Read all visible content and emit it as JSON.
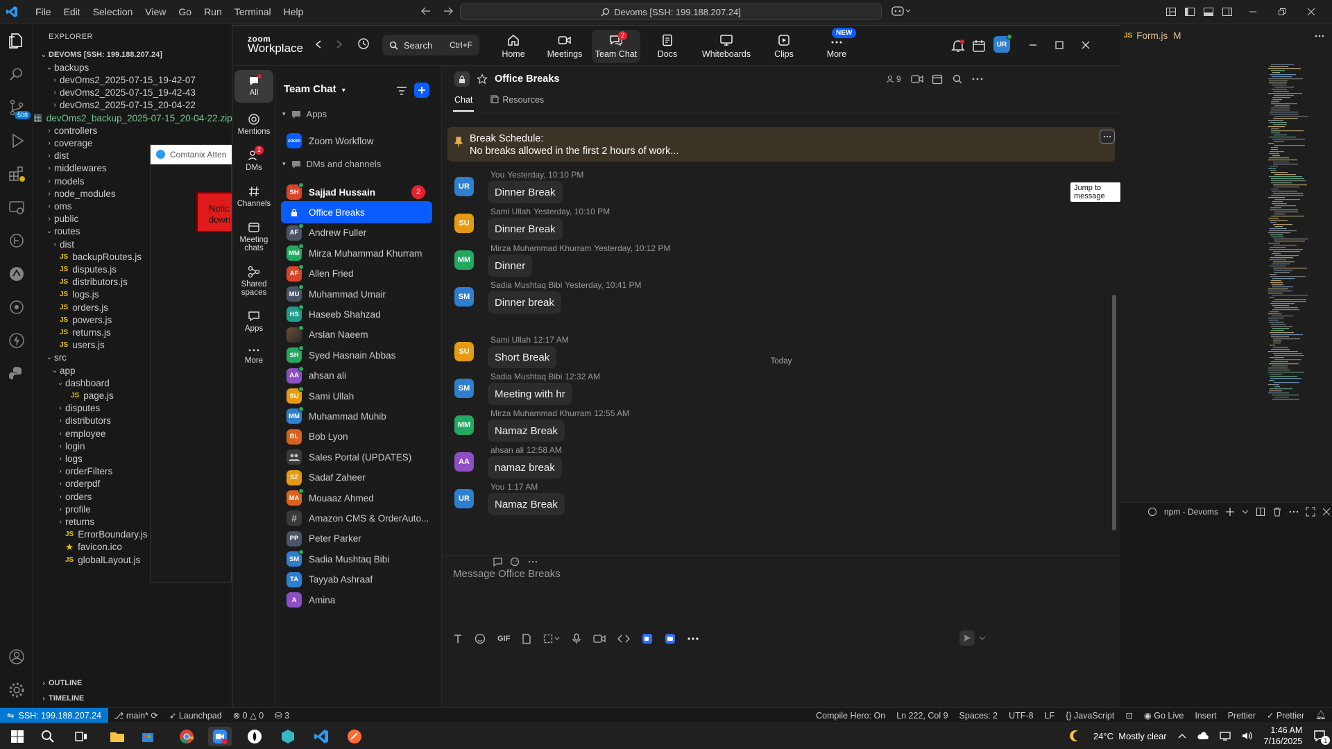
{
  "vscode": {
    "menu": [
      "File",
      "Edit",
      "Selection",
      "View",
      "Go",
      "Run",
      "Terminal",
      "Help"
    ],
    "command_center": "Devoms [SSH: 199.188.207.24]",
    "activity_badge": "508",
    "explorer_title": "EXPLORER",
    "tree": [
      {
        "label": "DEVOMS [SSH: 199.188.207.24]",
        "type": "root"
      },
      {
        "label": "backups",
        "type": "folder-open",
        "indent": 1
      },
      {
        "label": "devOms2_2025-07-15_19-42-07",
        "type": "folder",
        "indent": 2
      },
      {
        "label": "devOms2_2025-07-15_19-42-43",
        "type": "folder",
        "indent": 2
      },
      {
        "label": "devOms2_2025-07-15_20-04-22",
        "type": "folder",
        "indent": 2
      },
      {
        "label": "devOms2_backup_2025-07-15_20-04-22.zip",
        "type": "file-green",
        "indent": 2
      },
      {
        "label": "controllers",
        "type": "folder",
        "indent": 1
      },
      {
        "label": "coverage",
        "type": "folder",
        "indent": 1
      },
      {
        "label": "dist",
        "type": "folder",
        "indent": 1
      },
      {
        "label": "middlewares",
        "type": "folder",
        "indent": 1
      },
      {
        "label": "models",
        "type": "folder",
        "indent": 1
      },
      {
        "label": "node_modules",
        "type": "folder",
        "indent": 1
      },
      {
        "label": "oms",
        "type": "folder",
        "indent": 1
      },
      {
        "label": "public",
        "type": "folder",
        "indent": 1
      },
      {
        "label": "routes",
        "type": "folder-open",
        "indent": 1
      },
      {
        "label": "dist",
        "type": "folder",
        "indent": 2
      },
      {
        "label": "backupRoutes.js",
        "type": "js",
        "indent": 2
      },
      {
        "label": "disputes.js",
        "type": "js",
        "indent": 2
      },
      {
        "label": "distributors.js",
        "type": "js",
        "indent": 2
      },
      {
        "label": "logs.js",
        "type": "js",
        "indent": 2
      },
      {
        "label": "orders.js",
        "type": "js",
        "indent": 2
      },
      {
        "label": "powers.js",
        "type": "js",
        "indent": 2
      },
      {
        "label": "returns.js",
        "type": "js",
        "indent": 2
      },
      {
        "label": "users.js",
        "type": "js",
        "indent": 2
      },
      {
        "label": "src",
        "type": "folder-open",
        "indent": 1
      },
      {
        "label": "app",
        "type": "folder-open",
        "indent": 2
      },
      {
        "label": "dashboard",
        "type": "folder-open",
        "indent": 3
      },
      {
        "label": "page.js",
        "type": "js",
        "indent": 4
      },
      {
        "label": "disputes",
        "type": "folder",
        "indent": 3
      },
      {
        "label": "distributors",
        "type": "folder",
        "indent": 3
      },
      {
        "label": "employee",
        "type": "folder",
        "indent": 3
      },
      {
        "label": "login",
        "type": "folder",
        "indent": 3
      },
      {
        "label": "logs",
        "type": "folder",
        "indent": 3
      },
      {
        "label": "orderFilters",
        "type": "folder",
        "indent": 3
      },
      {
        "label": "orderpdf",
        "type": "folder",
        "indent": 3
      },
      {
        "label": "orders",
        "type": "folder",
        "indent": 3
      },
      {
        "label": "profile",
        "type": "folder",
        "indent": 3
      },
      {
        "label": "returns",
        "type": "folder",
        "indent": 3
      },
      {
        "label": "ErrorBoundary.js",
        "type": "js",
        "indent": 3
      },
      {
        "label": "favicon.ico",
        "type": "star",
        "indent": 3
      },
      {
        "label": "globalLayout.js",
        "type": "js",
        "indent": 3
      }
    ],
    "outline": "OUTLINE",
    "timeline": "TIMELINE",
    "behind_tab": "Comtanix Atten",
    "behind_notice": "Notic down",
    "editor_tab": "Form.js",
    "editor_tab_status": "M",
    "terminal_label": "npm - Devoms",
    "status": {
      "remote": "SSH: 199.188.207.24",
      "branch": "main*",
      "launchpad": "Launchpad",
      "problems": "0",
      "warnings": "0",
      "ports": "3",
      "compile_hero": "Compile Hero: On",
      "position": "Ln 222, Col 9",
      "spaces": "Spaces: 2",
      "encoding": "UTF-8",
      "eol": "LF",
      "language": "JavaScript",
      "golive": "Go Live",
      "mode": "Insert",
      "prettier1": "Prettier",
      "prettier2": "Prettier"
    }
  },
  "zoom": {
    "logo_top": "zoom",
    "logo_bottom": "Workplace",
    "search_label": "Search",
    "search_shortcut": "Ctrl+F",
    "nav": [
      {
        "label": "Home"
      },
      {
        "label": "Meetings"
      },
      {
        "label": "Team Chat",
        "badge": "2"
      },
      {
        "label": "Docs"
      },
      {
        "label": "Whiteboards"
      },
      {
        "label": "Clips"
      },
      {
        "label": "More",
        "tag": "NEW"
      }
    ],
    "avatar": "UR",
    "rail": [
      {
        "label": "All"
      },
      {
        "label": "Mentions"
      },
      {
        "label": "DMs",
        "badge": "2"
      },
      {
        "label": "Channels"
      },
      {
        "label": "Meeting chats"
      },
      {
        "label": "Shared spaces"
      },
      {
        "label": "Apps"
      },
      {
        "label": "More"
      }
    ],
    "list_title": "Team Chat",
    "section_apps": "Apps",
    "section_dms": "DMs and channels",
    "apps": [
      {
        "name": "Zoom Workflow",
        "initials": "zoom",
        "color": "#0b5cff"
      }
    ],
    "conversations": [
      {
        "name": "Sajjad Hussain",
        "initials": "SH",
        "color": "#d8452b",
        "badge": "2",
        "bold": true,
        "online": true
      },
      {
        "name": "Office Breaks",
        "initials": "",
        "color": "#0b5cff",
        "selected": true,
        "lock": true
      },
      {
        "name": "Andrew Fuller",
        "initials": "AF",
        "color": "#4a5568",
        "online": true
      },
      {
        "name": "Mirza Muhammad Khurram",
        "initials": "MM",
        "color": "#22a860",
        "online": true
      },
      {
        "name": "Allen Fried",
        "initials": "AF",
        "color": "#d8452b",
        "online": true
      },
      {
        "name": "Muhammad Umair",
        "initials": "MU",
        "color": "#4a5568",
        "online": true
      },
      {
        "name": "Haseeb Shahzad",
        "initials": "HS",
        "color": "#1e9e8a",
        "online": true
      },
      {
        "name": "Arslan Naeem",
        "initials": "",
        "color": "#6b4f3a",
        "online": true
      },
      {
        "name": "Syed Hasnain Abbas",
        "initials": "SH",
        "color": "#22a860",
        "online": true
      },
      {
        "name": "ahsan ali",
        "initials": "AA",
        "color": "#8e4ec6",
        "online": true
      },
      {
        "name": "Sami Ullah",
        "initials": "SU",
        "color": "#e59a12",
        "online": true
      },
      {
        "name": "Muhammad Muhib",
        "initials": "MM",
        "color": "#2f7fd1",
        "online": true
      },
      {
        "name": "Bob Lyon",
        "initials": "BL",
        "color": "#d9631e",
        "online": false
      },
      {
        "name": "Sales Portal (UPDATES)",
        "initials": "",
        "color": "#3a3a3a",
        "group": true
      },
      {
        "name": "Sadaf Zaheer",
        "initials": "SZ",
        "color": "#e59a12",
        "online": false
      },
      {
        "name": "Mouaaz Ahmed",
        "initials": "MA",
        "color": "#d9631e",
        "online": true
      },
      {
        "name": "Amazon CMS & OrderAuto...",
        "initials": "#",
        "color": "#3a3a3a",
        "channel": true
      },
      {
        "name": "Peter Parker",
        "initials": "PP",
        "color": "#4a5568",
        "online": false
      },
      {
        "name": "Sadia Mushtaq Bibi",
        "initials": "SM",
        "color": "#2f7fd1",
        "online": true
      },
      {
        "name": "Tayyab Ashraaf",
        "initials": "TA",
        "color": "#2f7fd1",
        "online": false
      },
      {
        "name": "Amina",
        "initials": "A",
        "color": "#8e4ec6",
        "online": false
      }
    ],
    "chat": {
      "title": "Office Breaks",
      "member_count": "9",
      "tab_chat": "Chat",
      "tab_resources": "Resources",
      "pinned_title": "Break Schedule:",
      "pinned_text": "No breaks allowed in the first 2 hours of work...",
      "jump_tooltip": "Jump to message",
      "today": "Today",
      "messages": [
        {
          "sender": "You",
          "time": "Yesterday, 10:10 PM",
          "text": "Dinner Break",
          "initials": "UR",
          "color": "#2f7fd1"
        },
        {
          "sender": "Sami Ullah",
          "time": "Yesterday, 10:10 PM",
          "text": "Dinner Break",
          "initials": "SU",
          "color": "#e59a12"
        },
        {
          "sender": "Mirza Muhammad Khurram",
          "time": "Yesterday, 10:12 PM",
          "text": "Dinner",
          "initials": "MM",
          "color": "#22a860"
        },
        {
          "sender": "Sadia Mushtaq Bibi",
          "time": "Yesterday, 10:41 PM",
          "text": "Dinner break",
          "initials": "SM",
          "color": "#2f7fd1"
        },
        {
          "sender": "Sami Ullah",
          "time": "12:17 AM",
          "text": "Short Break",
          "initials": "SU",
          "color": "#e59a12"
        },
        {
          "sender": "Sadia Mushtaq Bibi",
          "time": "12:32 AM",
          "text": "Meeting with hr",
          "initials": "SM",
          "color": "#2f7fd1"
        },
        {
          "sender": "Mirza Muhammad Khurram",
          "time": "12:55 AM",
          "text": "Namaz Break",
          "initials": "MM",
          "color": "#22a860"
        },
        {
          "sender": "ahsan ali",
          "time": "12:58 AM",
          "text": "namaz break",
          "initials": "AA",
          "color": "#8e4ec6"
        },
        {
          "sender": "You",
          "time": "1:17 AM",
          "text": "Namaz Break",
          "initials": "UR",
          "color": "#2f7fd1"
        }
      ],
      "composer_placeholder": "Message Office Breaks",
      "gif_label": "GIF"
    }
  },
  "taskbar": {
    "weather_temp": "24°C",
    "weather_text": "Mostly clear",
    "time": "1:46 AM",
    "date": "7/16/2025",
    "notif_count": "1"
  }
}
